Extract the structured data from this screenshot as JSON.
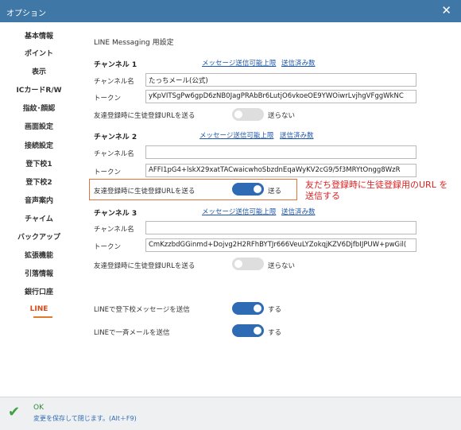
{
  "window": {
    "title": "オプション"
  },
  "sidebar": {
    "items": [
      {
        "label": "基本情報"
      },
      {
        "label": "ポイント"
      },
      {
        "label": "表示"
      },
      {
        "label": "ICカードR/W"
      },
      {
        "label": "指紋･顔認"
      },
      {
        "label": "画面設定"
      },
      {
        "label": "接続設定"
      },
      {
        "label": "登下校1"
      },
      {
        "label": "登下校2"
      },
      {
        "label": "音声案内"
      },
      {
        "label": "チャイム"
      },
      {
        "label": "バックアップ"
      },
      {
        "label": "拡張機能"
      },
      {
        "label": "引落情報"
      },
      {
        "label": "銀行口座"
      },
      {
        "label": "LINE"
      }
    ],
    "active_index": 15
  },
  "main": {
    "section_title": "LINE Messaging 用設定",
    "channels": [
      {
        "heading": "チャンネル 1",
        "link_limit": "メッセージ送信可能上限",
        "link_sent": "送信済み数",
        "name_label": "チャンネル名",
        "name_value": "たっちメール(公式)",
        "token_label": "トークン",
        "token_value": "yKpVITSgPw6gpD6zNB0JagPRAbBr6LutjO6vkoeOE9YWOiwrLvjhgVFggWkNC",
        "send_url_label": "友達登録時に生徒登録URLを送る",
        "toggle_state": "送らない"
      },
      {
        "heading": "チャンネル 2",
        "link_limit": "メッセージ送信可能上限",
        "link_sent": "送信済み数",
        "name_label": "チャンネル名",
        "name_value": "",
        "token_label": "トークン",
        "token_value": "AFFI1pG4+lskX29xatTACwaicwhoSbzdnEqaWyKV2cG9/5f3MRYtOngg8WzR",
        "send_url_label": "友達登録時に生徒登録URLを送る",
        "toggle_state": "送る"
      },
      {
        "heading": "チャンネル 3",
        "link_limit": "メッセージ送信可能上限",
        "link_sent": "送信済み数",
        "name_label": "チャンネル名",
        "name_value": "",
        "token_label": "トークン",
        "token_value": "CmKzzbdGGinmd+Dojvg2H2RFhBYTJr666VeuLYZokqjKZV6DjfbIJPUW+pwGil(",
        "send_url_label": "友達登録時に生徒登録URLを送る",
        "toggle_state": "送らない"
      }
    ],
    "annotation": "友だち登録時に生徒登録用のURL を送信する",
    "options": [
      {
        "label": "LINEで登下校メッセージを送信",
        "state": "する"
      },
      {
        "label": "LINEで一斉メールを送信",
        "state": "する"
      }
    ]
  },
  "footer": {
    "ok_label": "OK",
    "description": "変更を保存して閉じます。(Alt＋F9)"
  },
  "colors": {
    "titlebar": "#3f77a6",
    "toggle_on": "#2f6bb5",
    "toggle_off": "#dedede",
    "active_tab": "#d9491a",
    "annotation": "#e02020",
    "link": "#1d56a8"
  }
}
